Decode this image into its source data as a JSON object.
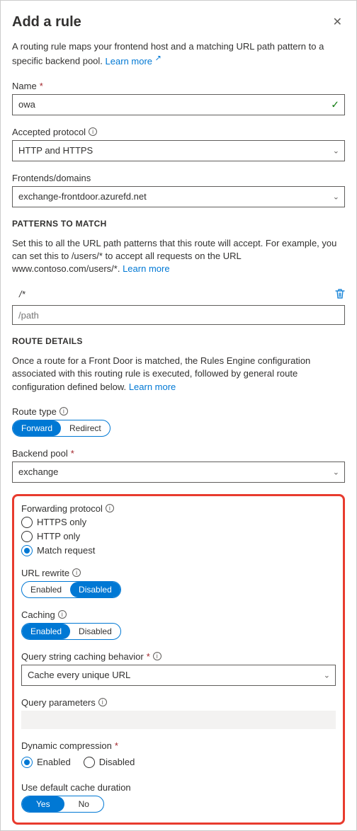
{
  "header": {
    "title": "Add a rule"
  },
  "description": "A routing rule maps your frontend host and a matching URL path pattern to a specific backend pool.",
  "learn_more": "Learn more",
  "fields": {
    "name": {
      "label": "Name",
      "value": "owa"
    },
    "accepted_protocol": {
      "label": "Accepted protocol",
      "value": "HTTP and HTTPS"
    },
    "frontends": {
      "label": "Frontends/domains",
      "value": "exchange-frontdoor.azurefd.net"
    }
  },
  "patterns": {
    "heading": "PATTERNS TO MATCH",
    "help": "Set this to all the URL path patterns that this route will accept. For example, you can set this to /users/* to accept all requests on the URL www.contoso.com/users/*.",
    "existing": "/*",
    "placeholder": "/path"
  },
  "route": {
    "heading": "ROUTE DETAILS",
    "help": "Once a route for a Front Door is matched, the Rules Engine configuration associated with this routing rule is executed, followed by general route configuration defined below.",
    "route_type": {
      "label": "Route type",
      "options": [
        "Forward",
        "Redirect"
      ],
      "selected": "Forward"
    },
    "backend_pool": {
      "label": "Backend pool",
      "value": "exchange"
    }
  },
  "fwd": {
    "forwarding_protocol": {
      "label": "Forwarding protocol",
      "options": [
        "HTTPS only",
        "HTTP only",
        "Match request"
      ],
      "selected": "Match request"
    },
    "url_rewrite": {
      "label": "URL rewrite",
      "options": [
        "Enabled",
        "Disabled"
      ],
      "selected": "Disabled"
    },
    "caching": {
      "label": "Caching",
      "options": [
        "Enabled",
        "Disabled"
      ],
      "selected": "Enabled"
    },
    "query_behavior": {
      "label": "Query string caching behavior",
      "value": "Cache every unique URL"
    },
    "query_params": {
      "label": "Query parameters"
    },
    "dyn_compression": {
      "label": "Dynamic compression",
      "options": [
        "Enabled",
        "Disabled"
      ],
      "selected": "Enabled"
    },
    "default_cache": {
      "label": "Use default cache duration",
      "options": [
        "Yes",
        "No"
      ],
      "selected": "Yes"
    }
  }
}
